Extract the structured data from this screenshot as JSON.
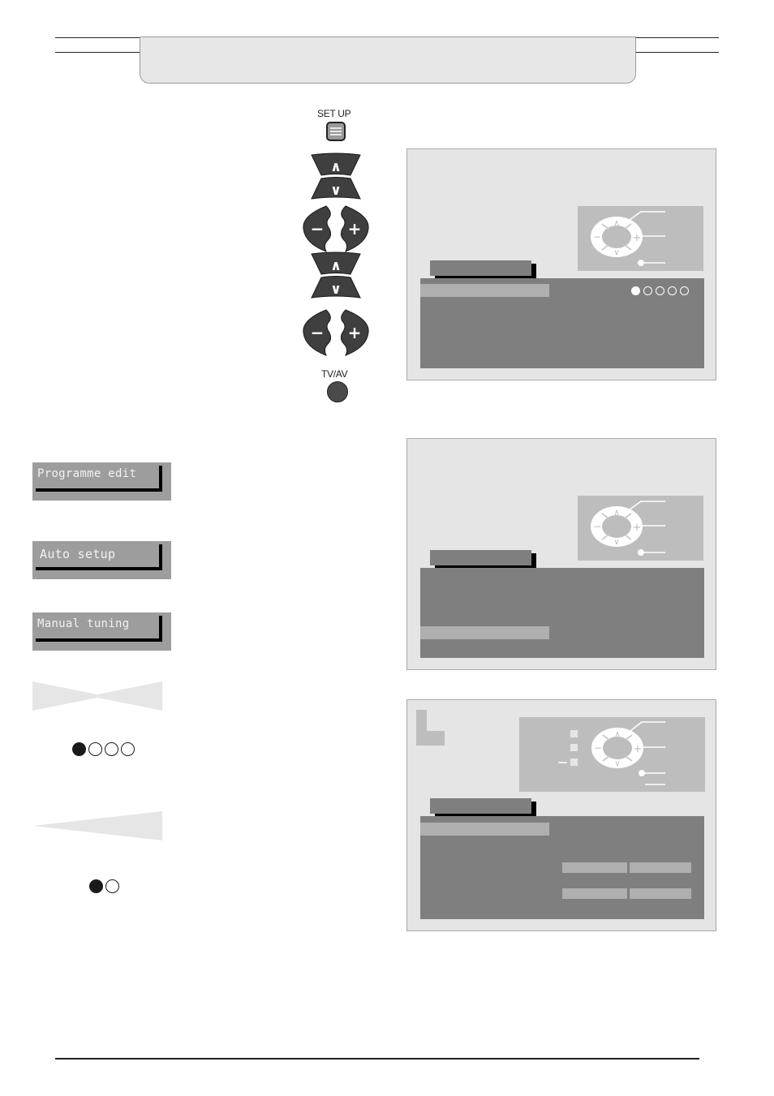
{
  "header": {
    "title": ""
  },
  "remote": {
    "setup_label": "SET UP",
    "tvav_label": "TV/AV",
    "buttons": [
      {
        "name": "up-button",
        "glyph": "∧"
      },
      {
        "name": "down-button",
        "glyph": "∨"
      },
      {
        "name": "minus-button",
        "glyph": "−"
      },
      {
        "name": "plus-button",
        "glyph": "+"
      },
      {
        "name": "up-button-2",
        "glyph": "∧"
      },
      {
        "name": "down-button-2",
        "glyph": "∨"
      },
      {
        "name": "minus-button-2",
        "glyph": "−"
      },
      {
        "name": "plus-button-2",
        "glyph": "+"
      }
    ]
  },
  "osd_buttons": [
    {
      "label": "Programme edit"
    },
    {
      "label": "Auto setup"
    },
    {
      "label": "Manual tuning"
    }
  ],
  "indicators": {
    "four_dots": {
      "total": 4,
      "filled": 1
    },
    "two_dots": {
      "total": 2,
      "filled": 1
    }
  },
  "screens": [
    {
      "progress_dots": {
        "total": 5,
        "filled": 1
      },
      "highlight_row": 1
    },
    {
      "highlight_row": 5
    },
    {
      "highlight_row": 1
    }
  ],
  "help_glyphs": {
    "up": "∧",
    "down": "∨",
    "minus": "−",
    "plus": "+"
  },
  "colors": {
    "screen_bg": "#e5e5e5",
    "panel": "#7f7f7f",
    "highlight": "#afafaf",
    "help_box": "#bdbdbd",
    "button_dark": "#3f3f3f"
  }
}
